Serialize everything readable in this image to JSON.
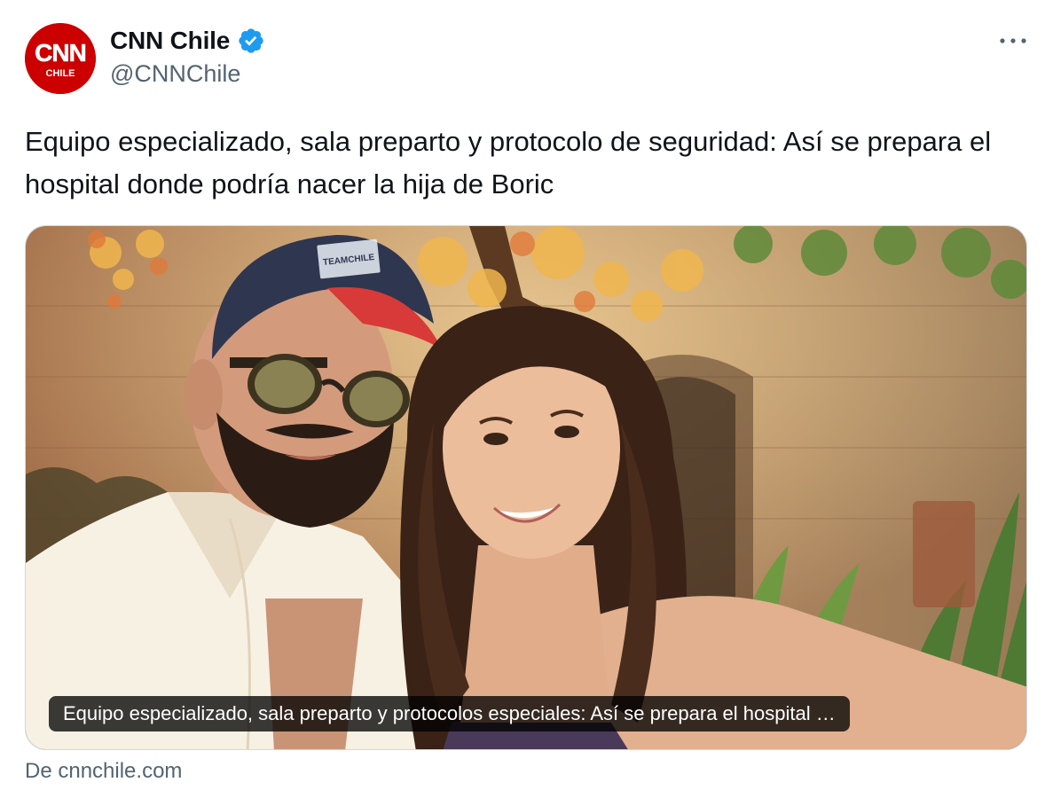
{
  "account": {
    "display_name": "CNN Chile",
    "handle": "@CNNChile",
    "verified": true,
    "avatar_text_top": "CNN",
    "avatar_text_bottom": "CHILE",
    "brand_color": "#cc0000",
    "verified_color": "#1d9bf0"
  },
  "tweet": {
    "text": "Equipo especializado, sala preparto y protocolo de seguridad: Así se prepara el hospital donde podría nacer la hija de Boric"
  },
  "card": {
    "caption": "Equipo especializado, sala preparto y protocolos especiales: Así se prepara el hospital …",
    "source": "De cnnchile.com",
    "cap_logo_text": "TEAMCHILE"
  },
  "icons": {
    "more": "more-horizontal-icon",
    "verified": "verified-badge-icon"
  }
}
